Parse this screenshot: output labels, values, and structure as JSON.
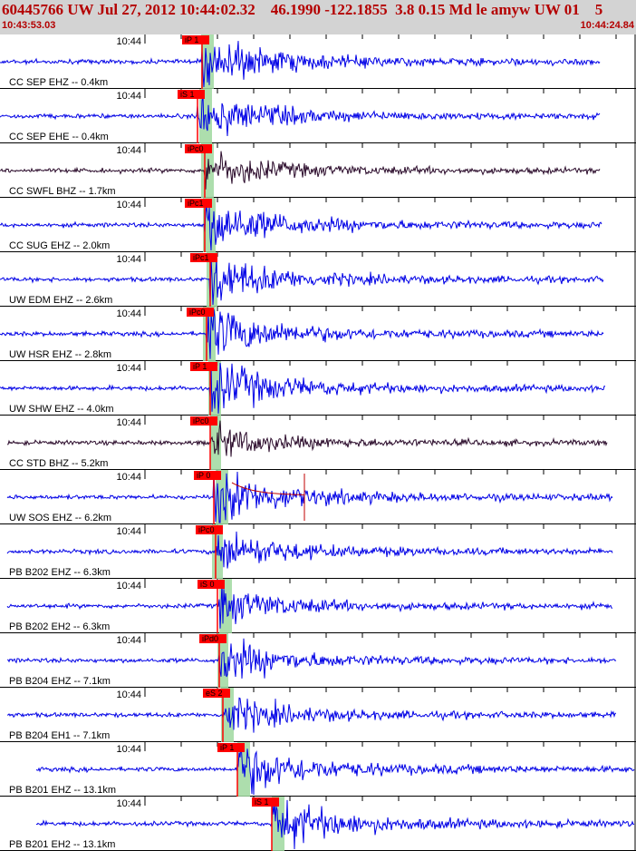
{
  "header": {
    "title": "60445766 UW Jul 27, 2012 10:44:02.32    46.1990 -122.1855  3.8 0.15 Md le amyw UW 01    5",
    "start_time": "10:43:53.03",
    "end_time": "10:44:24.84"
  },
  "time_tick_label": "10:44",
  "colors": {
    "background": "#ffffff",
    "header_bg": "#d3d3d3",
    "header_text": "#b40000",
    "trace_blue": "#0000e6",
    "trace_dark": "#2a0a2a",
    "pick_marker": "#ff0000",
    "window_green": "#9fd89f",
    "coda_red": "#c00000"
  },
  "traces": [
    {
      "label": "CC SEP EHZ -- 0.4km",
      "pick": "iP 1",
      "color": "blue",
      "amp": 1.0
    },
    {
      "label": "CC SEP EHE -- 0.4km",
      "pick": "iS 1",
      "color": "blue",
      "amp": 0.9
    },
    {
      "label": "CC SWFL BHZ -- 1.7km",
      "pick": "iPc0",
      "color": "dark",
      "amp": 0.7
    },
    {
      "label": "CC SUG EHZ -- 2.0km",
      "pick": "iPc1",
      "color": "blue",
      "amp": 1.0
    },
    {
      "label": "UW EDM EHZ -- 2.6km",
      "pick": "iPc1",
      "color": "blue",
      "amp": 0.9
    },
    {
      "label": "UW HSR EHZ -- 2.8km",
      "pick": "iPc0",
      "color": "blue",
      "amp": 1.0
    },
    {
      "label": "UW SHW EHZ -- 4.0km",
      "pick": "iP 1",
      "color": "blue",
      "amp": 1.0
    },
    {
      "label": "CC STD BHZ -- 5.2km",
      "pick": "iPc0",
      "color": "dark",
      "amp": 0.6
    },
    {
      "label": "UW SOS EHZ -- 6.2km",
      "pick": "iP 0",
      "color": "blue",
      "amp": 1.0,
      "coda": true
    },
    {
      "label": "PB B202 EHZ -- 6.3km",
      "pick": "iPc0",
      "color": "blue",
      "amp": 0.8
    },
    {
      "label": "PB B202 EH2 -- 6.3km",
      "pick": "iS 0",
      "color": "blue",
      "amp": 0.7
    },
    {
      "label": "PB B204 EHZ -- 7.1km",
      "pick": "iPd0",
      "color": "blue",
      "amp": 0.8
    },
    {
      "label": "PB B204 EH1 -- 7.1km",
      "pick": "eS 2",
      "color": "blue",
      "amp": 0.7
    },
    {
      "label": "PB B201 EHZ -- 13.1km",
      "pick": "iP 1",
      "color": "blue",
      "amp": 1.0
    },
    {
      "label": "PB B201 EH2 -- 13.1km",
      "pick": "iS 1",
      "color": "blue",
      "amp": 1.0
    }
  ]
}
